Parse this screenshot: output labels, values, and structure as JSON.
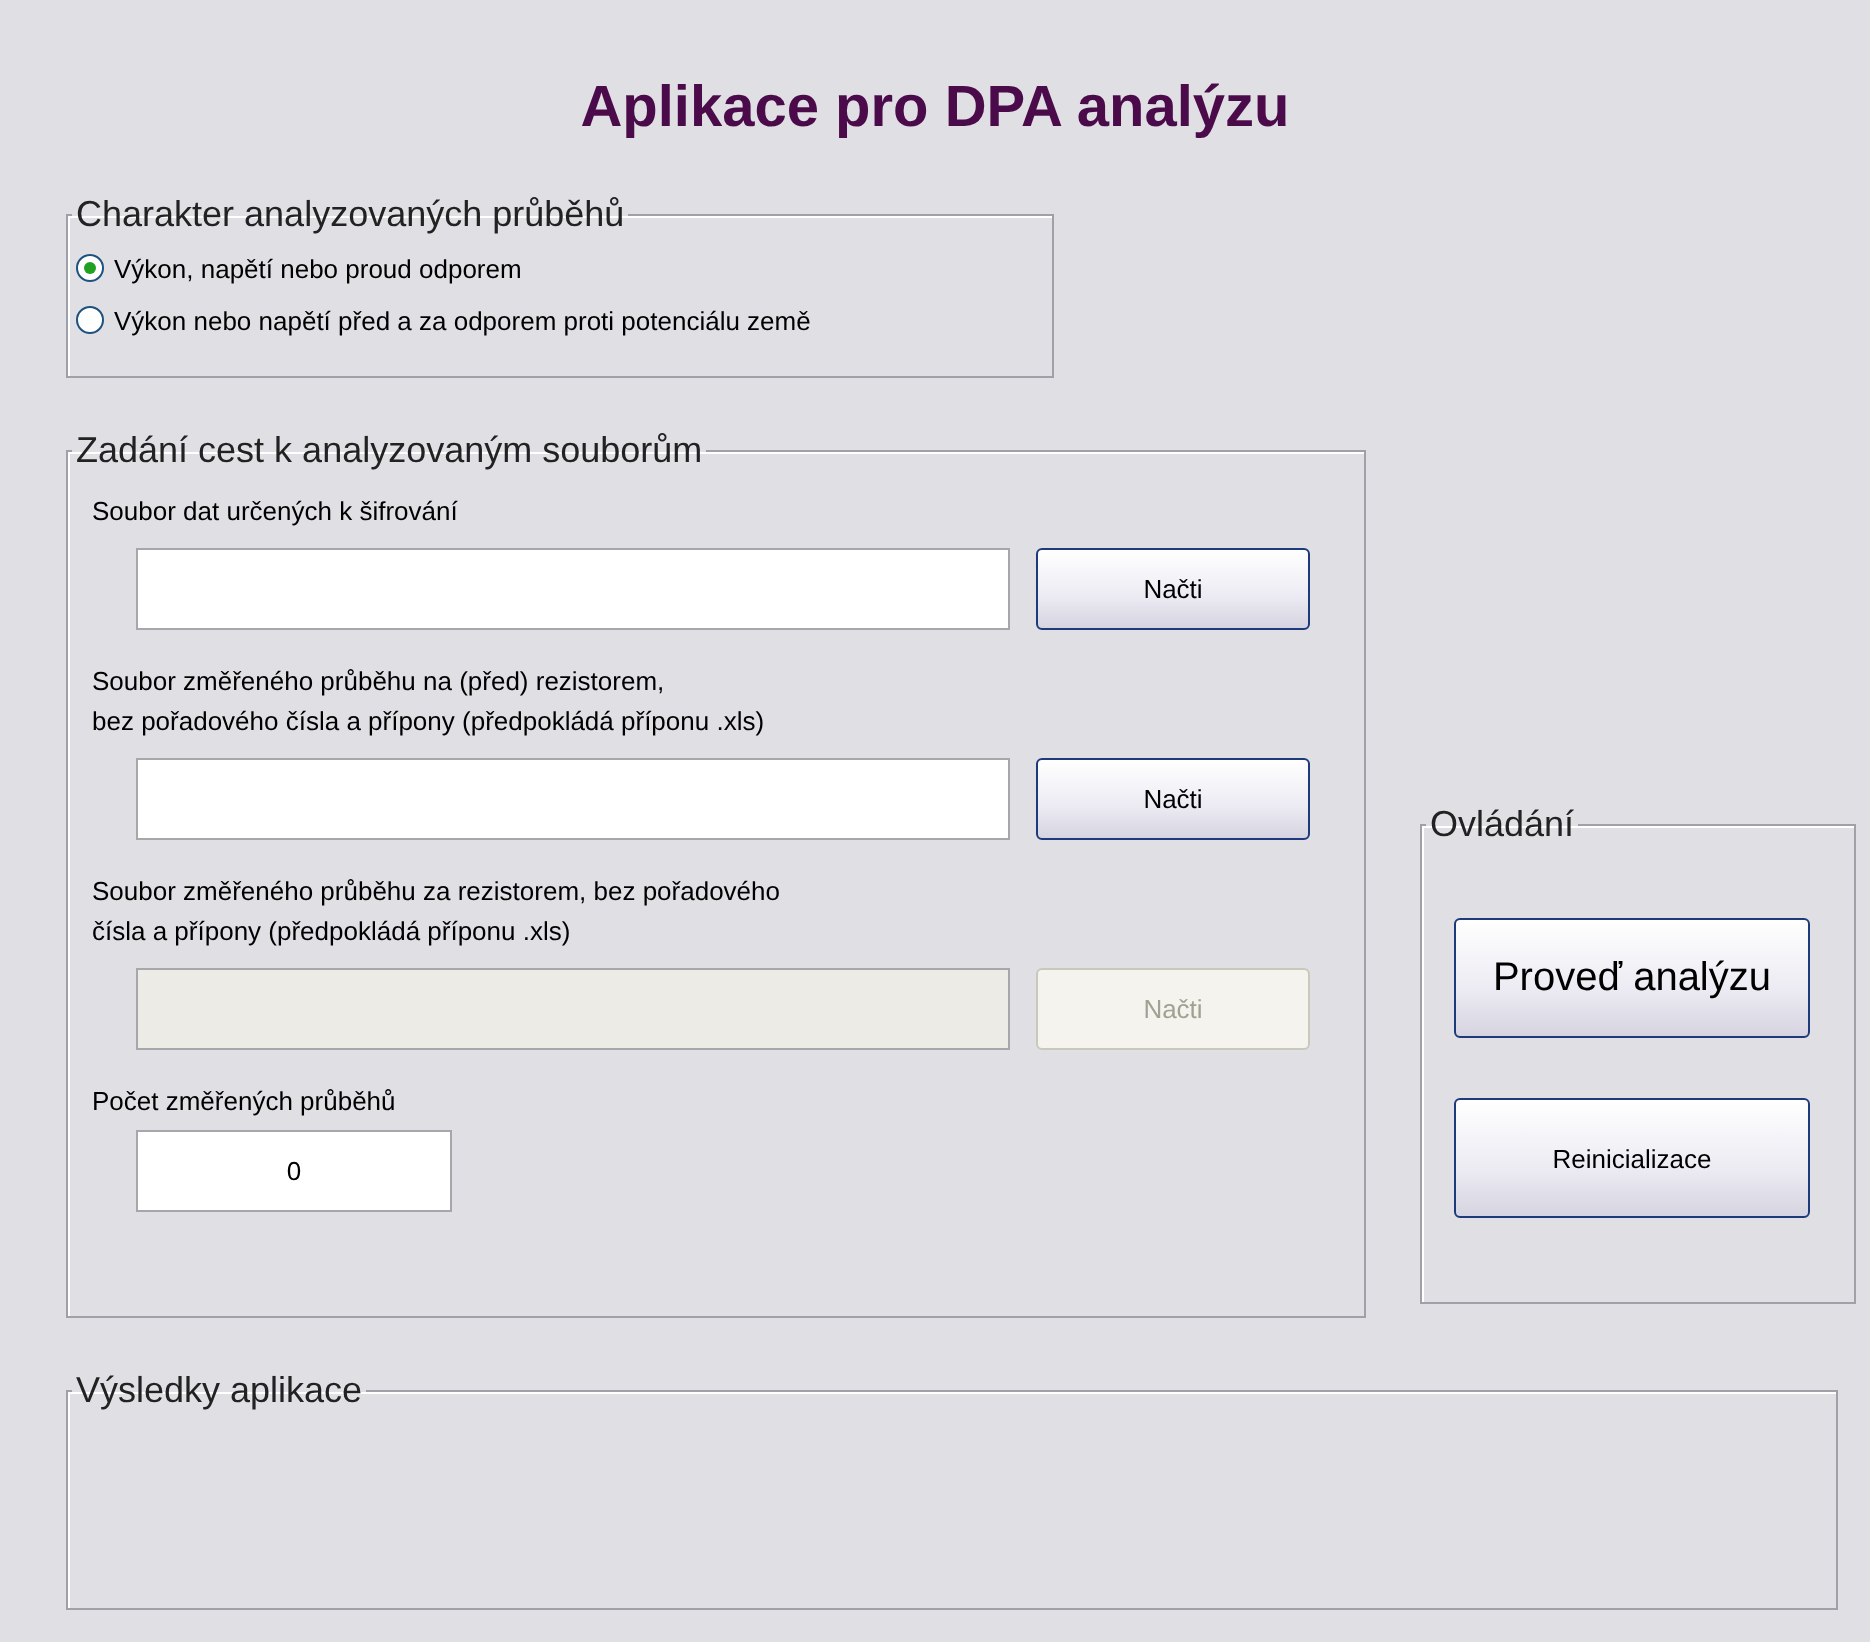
{
  "title": "Aplikace pro DPA analýzu",
  "mode_group": {
    "legend": "Charakter analyzovaných průběhů",
    "options": [
      {
        "label": "Výkon, napětí nebo proud odporem",
        "selected": true
      },
      {
        "label": "Výkon nebo napětí před a za odporem proti potenciálu země",
        "selected": false
      }
    ]
  },
  "paths_group": {
    "legend": "Zadání cest k analyzovaným souborům",
    "fields": [
      {
        "kind": "path",
        "label": "Soubor dat  určených k šifrování",
        "button": "Načti",
        "disabled": false
      },
      {
        "kind": "path",
        "label": "Soubor změřeného průběhu na (před) rezistorem,\nbez pořadového čísla a přípony (předpokládá příponu .xls)",
        "button": "Načti",
        "disabled": false
      },
      {
        "kind": "path",
        "label": "Soubor změřeného průběhu za rezistorem, bez pořadového\nčísla a přípony (předpokládá příponu .xls)",
        "button": "Načti",
        "disabled": true
      },
      {
        "kind": "count",
        "label": "Počet změřených průběhů",
        "value": "0"
      }
    ]
  },
  "controls_group": {
    "legend": "Ovládání",
    "buttons": [
      {
        "label": "Proveď analýzu",
        "kind": "large"
      },
      {
        "label": "Reinicializace",
        "kind": "normal"
      }
    ]
  },
  "results_group": {
    "legend": "Výsledky aplikace"
  }
}
